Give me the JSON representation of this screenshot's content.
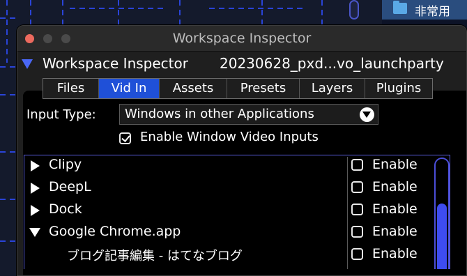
{
  "background": {
    "sidebar_folder_label": "非常用"
  },
  "window": {
    "title": "Workspace Inspector",
    "header_label": "Workspace Inspector",
    "workspace_name": "20230628_pxd...vo_launchparty"
  },
  "tabs": [
    {
      "label": "Files",
      "active": false
    },
    {
      "label": "Vid In",
      "active": true
    },
    {
      "label": "Assets",
      "active": false
    },
    {
      "label": "Presets",
      "active": false
    },
    {
      "label": "Layers",
      "active": false
    },
    {
      "label": "Plugins",
      "active": false
    }
  ],
  "input_type": {
    "label": "Input Type:",
    "selected": "Windows in other Applications"
  },
  "enable_window_video": {
    "label": "Enable Window Video Inputs",
    "checked": true
  },
  "apps": [
    {
      "name": "Clipy",
      "expanded": false,
      "enable_label": "Enable",
      "enabled": false
    },
    {
      "name": "DeepL",
      "expanded": false,
      "enable_label": "Enable",
      "enabled": false
    },
    {
      "name": "Dock",
      "expanded": false,
      "enable_label": "Enable",
      "enabled": false
    },
    {
      "name": "Google Chrome.app",
      "expanded": true,
      "enable_label": "Enable",
      "enabled": false
    },
    {
      "name": "ブログ記事編集 - はてなブログ",
      "child": true,
      "enable_label": "Enable",
      "enabled": false
    }
  ],
  "colors": {
    "accent_blue": "#1f50d8",
    "triangle_blue": "#4a67f5",
    "close_red": "#ed6a5e"
  }
}
